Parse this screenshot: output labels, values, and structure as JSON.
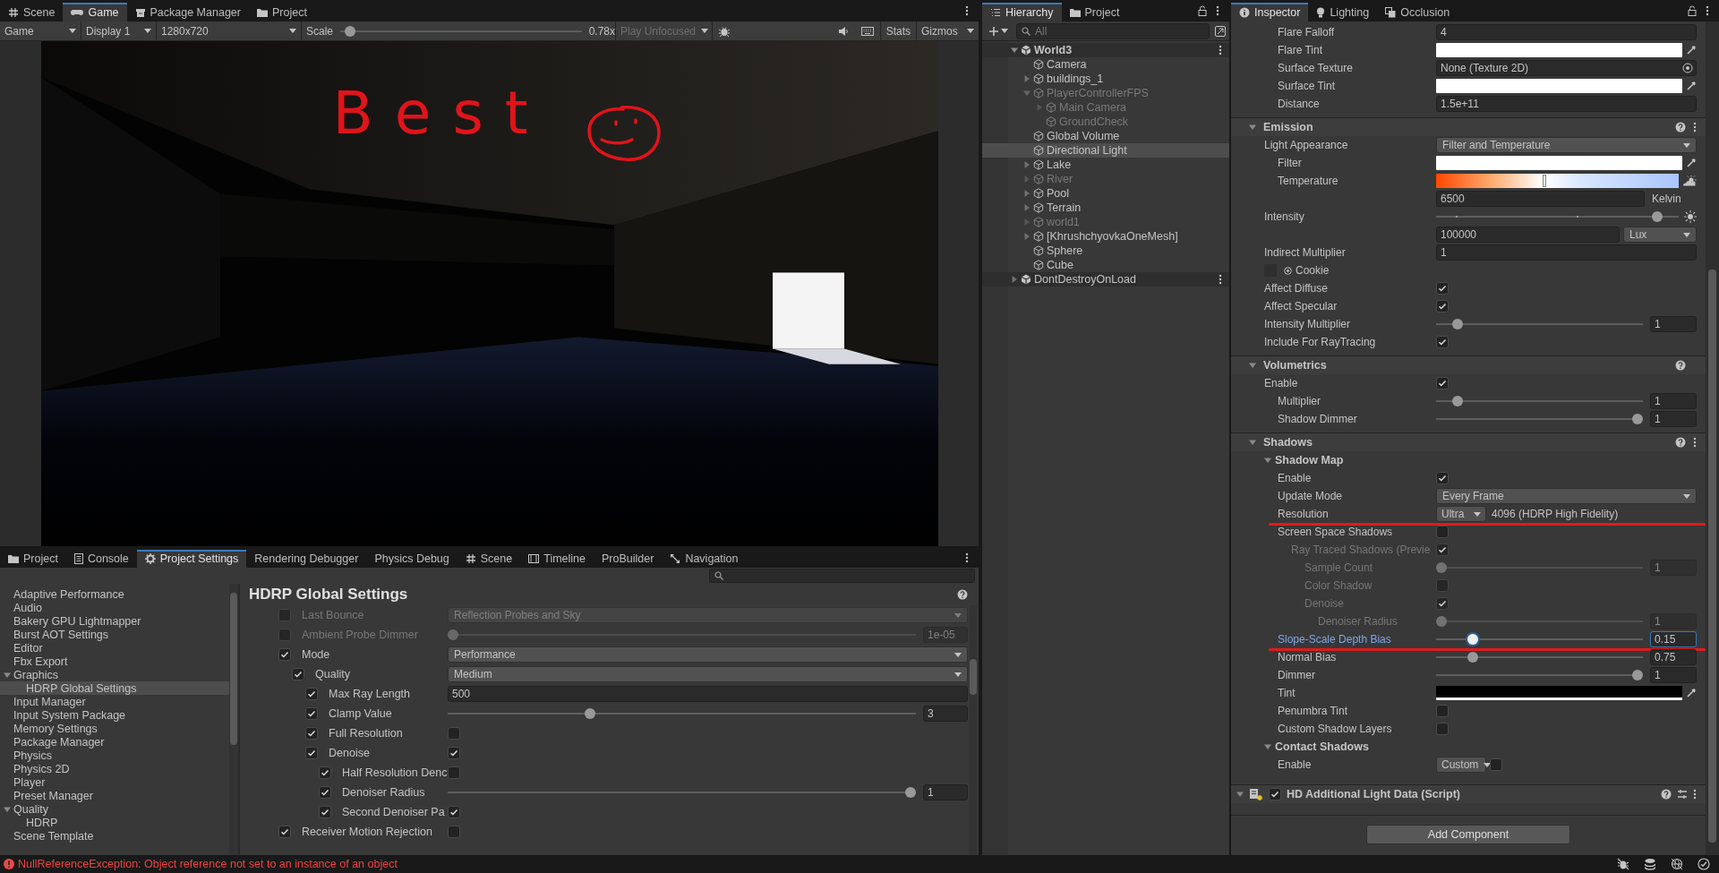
{
  "top_tabs": [
    {
      "label": "Scene",
      "kind": "scene",
      "selected": false
    },
    {
      "label": "Game",
      "kind": "game",
      "selected": true
    },
    {
      "label": "Package Manager",
      "kind": "package",
      "selected": false
    },
    {
      "label": "Project",
      "kind": "folder",
      "selected": false
    }
  ],
  "game_toolbar": {
    "display_mode": "Game",
    "display": "Display 1",
    "resolution": "1280x720",
    "scale": {
      "label": "Scale",
      "level": 0.02,
      "value": "0.78x"
    },
    "play_mode": {
      "label": "Play Unfocused",
      "disabled": true
    },
    "stats": "Stats",
    "gizmos": "Gizmos"
  },
  "game_view": {
    "annotation": "Best"
  },
  "hierarchy": {
    "tabs": [
      {
        "label": "Hierarchy",
        "kind": "list",
        "selected": true
      },
      {
        "label": "Project",
        "kind": "folder",
        "selected": false
      }
    ],
    "search": {
      "placeholder": "All"
    },
    "items": [
      {
        "label": "World3",
        "kind": "scene",
        "active": true,
        "expanded": true,
        "selected": false,
        "children": [
          {
            "label": "Camera",
            "kind": "object",
            "active": true,
            "selected": false
          },
          {
            "label": "buildings_1",
            "kind": "object",
            "active": true,
            "expanded": false,
            "selected": false
          },
          {
            "label": "PlayerControllerFPS",
            "kind": "object",
            "active": false,
            "expanded": true,
            "selected": false,
            "children": [
              {
                "label": "Main Camera",
                "kind": "object",
                "active": false,
                "expanded": false,
                "selected": false
              },
              {
                "label": "GroundCheck",
                "kind": "object",
                "active": false,
                "selected": false
              }
            ]
          },
          {
            "label": "Global Volume",
            "kind": "object",
            "active": true,
            "selected": false
          },
          {
            "label": "Directional Light",
            "kind": "object",
            "active": true,
            "selected": true
          },
          {
            "label": "Lake",
            "kind": "object",
            "active": true,
            "expanded": false,
            "selected": false
          },
          {
            "label": "River",
            "kind": "object",
            "active": false,
            "expanded": false,
            "selected": false
          },
          {
            "label": "Pool",
            "kind": "object",
            "active": true,
            "expanded": false,
            "selected": false
          },
          {
            "label": "Terrain",
            "kind": "object",
            "active": true,
            "expanded": false,
            "selected": false
          },
          {
            "label": "world1",
            "kind": "object",
            "active": false,
            "expanded": false,
            "selected": false
          },
          {
            "label": "[KhrushchyovkaOneMesh]",
            "kind": "object",
            "active": true,
            "expanded": false,
            "selected": false
          },
          {
            "label": "Sphere",
            "kind": "object",
            "active": true,
            "selected": false
          },
          {
            "label": "Cube",
            "kind": "object",
            "active": true,
            "selected": false
          }
        ]
      },
      {
        "label": "DontDestroyOnLoad",
        "kind": "scene",
        "active": false,
        "expanded": false,
        "selected": false
      }
    ]
  },
  "inspector": {
    "tabs": [
      {
        "label": "Inspector",
        "kind": "info",
        "selected": true
      },
      {
        "label": "Lighting",
        "kind": "bulb",
        "selected": false
      },
      {
        "label": "Occlusion",
        "kind": "occlusion",
        "selected": false
      }
    ],
    "sections": [
      {
        "rows": [
          {
            "kind": "number",
            "label": "Flare Falloff",
            "value": "4"
          },
          {
            "kind": "color",
            "label": "Flare Tint",
            "color": "#ffffff"
          },
          {
            "kind": "object",
            "label": "Surface Texture",
            "value": "None (Texture 2D)"
          },
          {
            "kind": "color",
            "label": "Surface Tint",
            "color": "#ffffff"
          },
          {
            "kind": "number",
            "label": "Distance",
            "value": "1.5e+11"
          }
        ]
      },
      {
        "title": "Emission",
        "expanded": true,
        "menu": true,
        "rows": [
          {
            "kind": "dropdown",
            "label": "Light Appearance",
            "value": "Filter and Temperature",
            "children": [
              {
                "kind": "color",
                "label": "Filter",
                "color": "#ffffff"
              },
              {
                "kind": "temperature",
                "label": "Temperature",
                "level": 0.44,
                "value": "6500",
                "unit": "Kelvin"
              }
            ]
          },
          {
            "kind": "intensity",
            "label": "Intensity",
            "level": 0.93,
            "value": "100000",
            "unit": "Lux"
          },
          {
            "kind": "number",
            "label": "Indirect Multiplier",
            "value": "1"
          },
          {
            "kind": "cookie",
            "label": "Cookie"
          },
          {
            "kind": "checkbox",
            "label": "Affect Diffuse",
            "checked": true
          },
          {
            "kind": "checkbox",
            "label": "Affect Specular",
            "checked": true
          },
          {
            "kind": "slider",
            "label": "Intensity Multiplier",
            "level": 0.08,
            "value": "1"
          },
          {
            "kind": "checkbox",
            "label": "Include For RayTracing",
            "checked": true
          }
        ]
      },
      {
        "title": "Volumetrics",
        "expanded": true,
        "menu": false,
        "rows": [
          {
            "kind": "checkbox",
            "label": "Enable",
            "checked": true,
            "children": [
              {
                "kind": "slider",
                "label": "Multiplier",
                "level": 0.08,
                "value": "1"
              },
              {
                "kind": "slider",
                "label": "Shadow Dimmer",
                "level": 1,
                "value": "1"
              }
            ]
          }
        ]
      },
      {
        "title": "Shadows",
        "expanded": true,
        "menu": true,
        "rows": [
          {
            "kind": "subsection",
            "label": "Shadow Map",
            "expanded": true,
            "children": [
              {
                "kind": "checkbox",
                "label": "Enable",
                "checked": true
              },
              {
                "kind": "dropdown",
                "label": "Update Mode",
                "value": "Every Frame"
              },
              {
                "kind": "dropdown_note",
                "label": "Resolution",
                "value": "Ultra",
                "note": "4096 (HDRP High Fidelity)",
                "annotated": true
              },
              {
                "kind": "checkbox",
                "label": "Screen Space Shadows",
                "checked": false,
                "children": [
                  {
                    "kind": "checkbox",
                    "label": "Ray Traced Shadows (Previe",
                    "checked": true,
                    "disabled": true,
                    "children": [
                      {
                        "kind": "slider",
                        "label": "Sample Count",
                        "level": 0,
                        "value": "1"
                      },
                      {
                        "kind": "checkbox",
                        "label": "Color Shadow",
                        "checked": false
                      },
                      {
                        "kind": "checkbox",
                        "label": "Denoise",
                        "checked": true,
                        "children": [
                          {
                            "kind": "slider",
                            "label": "Denoiser Radius",
                            "level": 0,
                            "value": "1"
                          }
                        ]
                      }
                    ]
                  }
                ]
              },
              {
                "kind": "slider",
                "label": "Slope-Scale Depth Bias",
                "level": 0.16,
                "value": "0.15",
                "focused": true,
                "annotated": true
              },
              {
                "kind": "slider",
                "label": "Normal Bias",
                "level": 0.16,
                "value": "0.75"
              },
              {
                "kind": "slider",
                "label": "Dimmer",
                "level": 1,
                "value": "1"
              },
              {
                "kind": "color",
                "label": "Tint",
                "color": "#000000"
              },
              {
                "kind": "checkbox",
                "label": "Penumbra Tint",
                "checked": false
              },
              {
                "kind": "checkbox",
                "label": "Custom Shadow Layers",
                "checked": false
              }
            ]
          },
          {
            "kind": "subsection",
            "label": "Contact Shadows",
            "expanded": true,
            "children": [
              {
                "kind": "dropdown_checkbox",
                "label": "Enable",
                "value": "Custom",
                "checked": false
              }
            ]
          }
        ]
      }
    ],
    "component": {
      "title": "HD Additional Light Data (Script)",
      "enabled": true,
      "expanded": true
    },
    "add_component": "Add Component"
  },
  "bottom_panel": {
    "tabs": [
      {
        "label": "Project",
        "kind": "folder",
        "selected": false
      },
      {
        "label": "Console",
        "kind": "console",
        "selected": false
      },
      {
        "label": "Project Settings",
        "kind": "gear",
        "selected": true
      },
      {
        "label": "Rendering Debugger",
        "kind": "plain",
        "selected": false
      },
      {
        "label": "Physics Debug",
        "kind": "plain",
        "selected": false
      },
      {
        "label": "Scene",
        "kind": "scene",
        "selected": false
      },
      {
        "label": "Timeline",
        "kind": "timeline",
        "selected": false
      },
      {
        "label": "ProBuilder",
        "kind": "plain",
        "selected": false
      },
      {
        "label": "Navigation",
        "kind": "navigation",
        "selected": false
      }
    ],
    "settings_list": [
      {
        "label": "Adaptive Performance",
        "selected": false
      },
      {
        "label": "Audio",
        "selected": false
      },
      {
        "label": "Bakery GPU Lightmapper",
        "selected": false
      },
      {
        "label": "Burst AOT Settings",
        "selected": false
      },
      {
        "label": "Editor",
        "selected": false
      },
      {
        "label": "Fbx Export",
        "selected": false
      },
      {
        "label": "Graphics",
        "expanded": true,
        "selected": false,
        "children": [
          {
            "label": "HDRP Global Settings",
            "selected": true
          }
        ]
      },
      {
        "label": "Input Manager",
        "selected": false
      },
      {
        "label": "Input System Package",
        "selected": false
      },
      {
        "label": "Memory Settings",
        "selected": false
      },
      {
        "label": "Package Manager",
        "selected": false
      },
      {
        "label": "Physics",
        "selected": false
      },
      {
        "label": "Physics 2D",
        "selected": false
      },
      {
        "label": "Player",
        "selected": false
      },
      {
        "label": "Preset Manager",
        "selected": false
      },
      {
        "label": "Quality",
        "expanded": true,
        "selected": false,
        "children": [
          {
            "label": "HDRP",
            "selected": false
          }
        ]
      },
      {
        "label": "Scene Template",
        "selected": false
      }
    ],
    "page": {
      "title": "HDRP Global Settings",
      "rows": [
        {
          "kind": "dropdown",
          "label": "Last Bounce",
          "value": "Reflection Probes and Sky",
          "override": false,
          "disabled": true
        },
        {
          "kind": "slider",
          "label": "Ambient Probe Dimmer",
          "level": 0,
          "value": "1e-05",
          "override": false,
          "disabled": true
        },
        {
          "kind": "dropdown",
          "label": "Mode",
          "value": "Performance",
          "override": true,
          "disabled": false,
          "children": [
            {
              "kind": "dropdown",
              "label": "Quality",
              "value": "Medium",
              "override": true,
              "disabled": false,
              "children": [
                {
                  "kind": "number",
                  "label": "Max Ray Length",
                  "value": "500",
                  "override": true,
                  "disabled": false
                },
                {
                  "kind": "slider",
                  "label": "Clamp Value",
                  "level": 0.3,
                  "value": "3",
                  "override": true,
                  "disabled": false
                },
                {
                  "kind": "checkbox",
                  "label": "Full Resolution",
                  "checked": false,
                  "override": true,
                  "disabled": false
                },
                {
                  "kind": "checkbox",
                  "label": "Denoise",
                  "checked": true,
                  "override": true,
                  "disabled": false,
                  "children": [
                    {
                      "kind": "checkbox",
                      "label": "Half Resolution Denc",
                      "checked": false,
                      "override": true,
                      "disabled": false
                    },
                    {
                      "kind": "slider",
                      "label": "Denoiser Radius",
                      "level": 1,
                      "value": "1",
                      "override": true,
                      "disabled": false
                    },
                    {
                      "kind": "checkbox",
                      "label": "Second Denoiser Pa",
                      "checked": true,
                      "override": true,
                      "disabled": false
                    }
                  ]
                }
              ]
            }
          ]
        },
        {
          "kind": "checkbox",
          "label": "Receiver Motion Rejection",
          "checked": false,
          "override": true,
          "disabled": false
        }
      ]
    }
  },
  "status_bar": {
    "kind": "error",
    "message": "NullReferenceException: Object reference not set to an instance of an object"
  }
}
